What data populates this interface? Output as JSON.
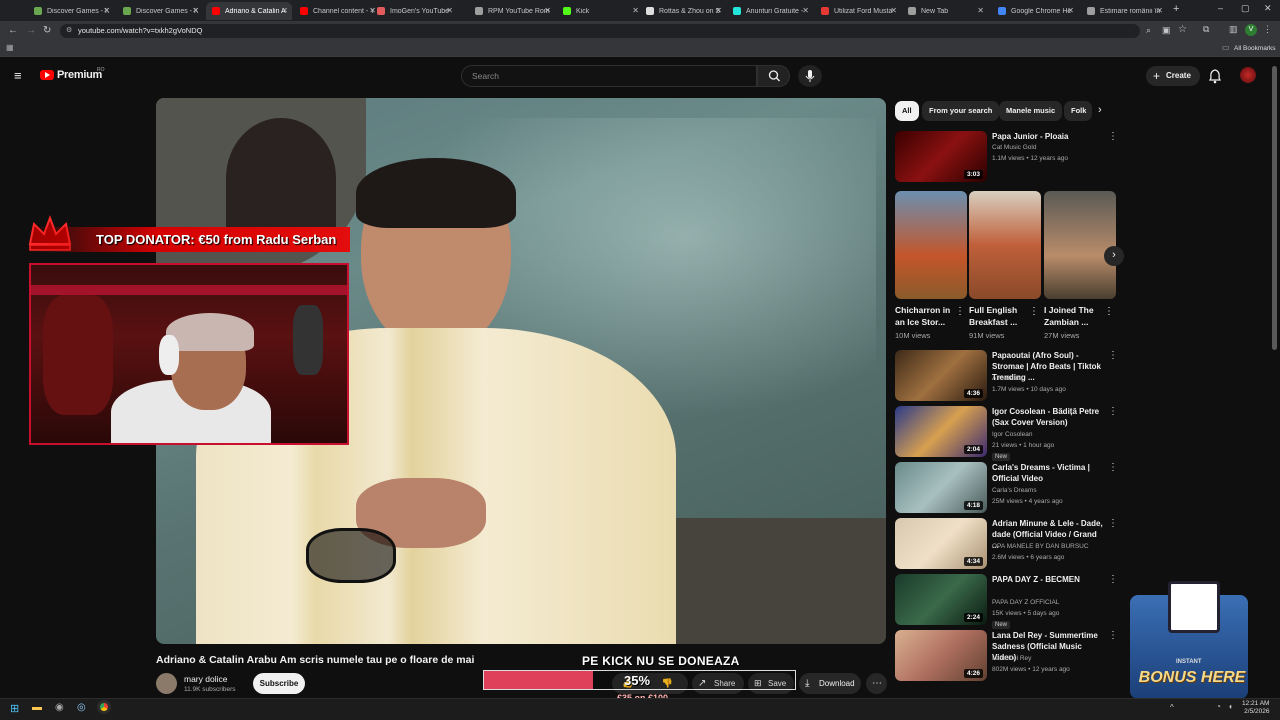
{
  "browser": {
    "tabs": [
      {
        "label": "Discover Games - K",
        "icon": "kick-icon",
        "color": "#6aa84f"
      },
      {
        "label": "Discover Games - K",
        "icon": "kick-icon",
        "color": "#6aa84f"
      },
      {
        "label": "Adriano & Catalin A",
        "icon": "youtube-icon",
        "color": "#ff0000",
        "active": true
      },
      {
        "label": "Channel content - Y",
        "icon": "youtube-icon",
        "color": "#ff0000"
      },
      {
        "label": "ImoGen's YouTube",
        "icon": "imogen-icon",
        "color": "#e45b5b"
      },
      {
        "label": "RPM YouTube Româ",
        "icon": "globe-icon",
        "color": "#9e9e9e"
      },
      {
        "label": "Kick",
        "icon": "kick-icon",
        "color": "#53fc18"
      },
      {
        "label": "Rottas & Zhou on S",
        "icon": "w-icon",
        "color": "#dddddd"
      },
      {
        "label": "Anunturi Gratuite -",
        "icon": "olx-icon",
        "color": "#23e5db"
      },
      {
        "label": "Utilizat Ford Musta",
        "icon": "autovit-icon",
        "color": "#e53935"
      },
      {
        "label": "New Tab",
        "icon": "globe-icon",
        "color": "#9e9e9e"
      },
      {
        "label": "Google Chrome He",
        "icon": "google-icon",
        "color": "#4285f4"
      },
      {
        "label": "Estimare românii în",
        "icon": "globe-icon",
        "color": "#9e9e9e"
      }
    ],
    "url": "youtube.com/watch?v=txkh2gVoNDQ",
    "bookmarks_label": "All Bookmarks"
  },
  "youtube": {
    "logo_text": "Premium",
    "logo_region": "RO",
    "search_placeholder": "Search",
    "create_label": "Create"
  },
  "video": {
    "title": "Adriano & Catalin Arabu Am scris numele tau pe o floare de mai",
    "channel": "mary dolice",
    "subscribers": "11.9K subscribers",
    "subscribe_label": "Subscribe",
    "actions": {
      "share": "Share",
      "save": "Save",
      "download": "Download"
    }
  },
  "overlay": {
    "top_donator": "TOP DONATOR: €50 from Radu Serban",
    "kick_banner": "PE KICK NU SE DONEAZA",
    "progress_fraction": 0.35,
    "progress_pct": "35%",
    "progress_goal": "€35 on €100",
    "bonus_label": "INSTANT",
    "bonus_text": "BONUS HERE"
  },
  "sidebar": {
    "chips": [
      "All",
      "From your search",
      "Manele music",
      "Folk"
    ],
    "first": {
      "title": "Papa Junior - Ploaia",
      "channel": "Cat Music Gold",
      "meta": "1.1M views • 12 years ago",
      "duration": "3:03"
    },
    "shorts": [
      {
        "title": "Chicharron in an Ice Stor...",
        "views": "10M views"
      },
      {
        "title": "Full English Breakfast ...",
        "views": "91M views"
      },
      {
        "title": "I Joined The Zambian ...",
        "views": "27M views"
      }
    ],
    "items": [
      {
        "title": "Papaoutai (Afro Soul) - Stromae | Afro Beats | Tiktok Trending ...",
        "channel": "Afro Beats",
        "meta": "1.7M views • 10 days ago",
        "duration": "4:36",
        "badge": ""
      },
      {
        "title": "Igor Cosolean -  Bădiță Petre (Sax Cover Version)",
        "channel": "Igor Cosolean",
        "meta": "21 views • 1 hour ago",
        "duration": "2:04",
        "badge": "New"
      },
      {
        "title": "Carla's Dreams - Victima | Official Video",
        "channel": "Carla's Dreams",
        "meta": "25M views • 4 years ago",
        "duration": "4:18",
        "badge": ""
      },
      {
        "title": "Adrian Minune & Lele - Dade, dade (Official Video / Grand ...",
        "channel": "OPA MANELE BY DAN BURSUC",
        "meta": "2.6M views • 6 years ago",
        "duration": "4:34",
        "badge": ""
      },
      {
        "title": "PAPA DAY Z - BECMEN",
        "channel": "PAPA DAY Z OFFICIAL",
        "meta": "15K views • 5 days ago",
        "duration": "2:24",
        "badge": "New"
      },
      {
        "title": "Lana Del Rey - Summertime Sadness (Official Music Video)",
        "channel": "Lana Del Rey",
        "meta": "802M views • 12 years ago",
        "duration": "4:26",
        "badge": ""
      }
    ]
  },
  "taskbar": {
    "time": "12:21 AM",
    "date": "2/5/2026"
  }
}
